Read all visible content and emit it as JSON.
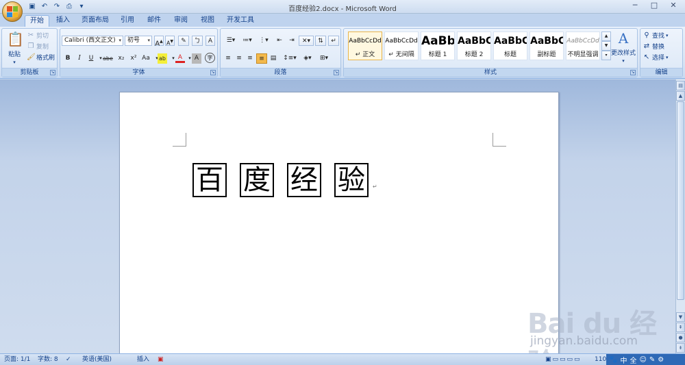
{
  "window": {
    "title": "百度经验2.docx - Microsoft Word",
    "minimize": "─",
    "maximize": "□",
    "close": "✕"
  },
  "qat": [
    "save-icon",
    "undo-icon",
    "redo-icon",
    "print-preview-icon",
    "customize-icon"
  ],
  "tabs": [
    "开始",
    "插入",
    "页面布局",
    "引用",
    "邮件",
    "审阅",
    "视图",
    "开发工具"
  ],
  "active_tab": "开始",
  "clipboard": {
    "label": "剪贴板",
    "paste": "粘贴",
    "cut": "剪切",
    "copy": "复制",
    "format_painter": "格式刷"
  },
  "font": {
    "label": "字体",
    "name": "Calibri (西文正文)",
    "size": "初号",
    "grow": "A",
    "shrink": "A",
    "bold": "B",
    "italic": "I",
    "underline": "U",
    "strike": "abe",
    "sub": "x₂",
    "sup": "x²",
    "case": "Aa",
    "highlight": "ab",
    "color": "A",
    "shade": "A",
    "enclose": "字"
  },
  "paragraph": {
    "label": "段落"
  },
  "styles": {
    "label": "样式",
    "items": [
      {
        "sample": "AaBbCcDd",
        "name": "↵ 正文"
      },
      {
        "sample": "AaBbCcDd",
        "name": "↵ 无间隔"
      },
      {
        "sample": "AaBb",
        "name": "标题 1"
      },
      {
        "sample": "AaBbC",
        "name": "标题 2"
      },
      {
        "sample": "AaBbC",
        "name": "标题"
      },
      {
        "sample": "AaBbC",
        "name": "副标题"
      },
      {
        "sample": "AaBbCcDd",
        "name": "不明显强调"
      }
    ],
    "change_styles": "更改样式"
  },
  "editing": {
    "label": "编辑",
    "find": "查找",
    "replace": "替换",
    "select": "选择"
  },
  "document": {
    "characters": [
      "百",
      "度",
      "经",
      "验"
    ],
    "pilcrow": "↵"
  },
  "watermark": {
    "logo": "Bai du 经验",
    "url": "jingyan.baidu.com"
  },
  "statusbar": {
    "page": "页面: 1/1",
    "words": "字数: 8",
    "language": "英语(美国)",
    "mode": "插入",
    "zoom": "110"
  },
  "ime": [
    "中",
    "全",
    "☺",
    "✎",
    "⚙"
  ]
}
